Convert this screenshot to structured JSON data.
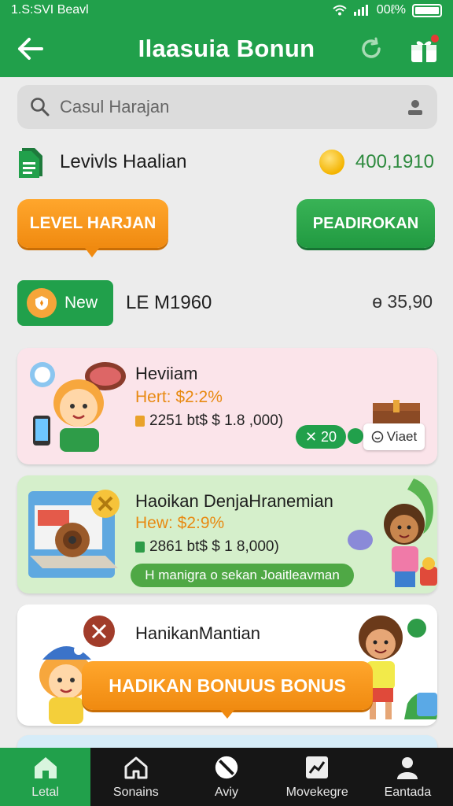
{
  "status_bar": {
    "time": "1.S:SVI Beavl",
    "battery": "00ℓ%"
  },
  "app_bar": {
    "title": "Ilaasuia Bonun"
  },
  "search": {
    "placeholder": "Casul Harajan"
  },
  "level": {
    "label": "Levivls Haalian",
    "coins": "400,1910"
  },
  "actions": {
    "level_button": "LEVEL HARJAN",
    "secondary_button": "PEADIROKAN"
  },
  "new_entry": {
    "badge": "New",
    "title": "LE M1960",
    "amount": "ɵ 35,90"
  },
  "cards": [
    {
      "title": "Heviiam",
      "subtitle": "Hert: $2:2%",
      "meta": "2251 bt$ $ 1.8 ,000)",
      "pill": "✕ 20",
      "pill_secondary": "Viaet"
    },
    {
      "title": "Haoikan DenjaHranemian",
      "subtitle": "Hew: $2:9%",
      "meta": "2861 bt$ $ 1 8,000)",
      "banner": "H manigra o sekan Joaitleavman"
    },
    {
      "title": "HanikanMantian",
      "button": "HADIKAN BONUUS BONUS"
    }
  ],
  "nav": [
    {
      "label": "Letal",
      "icon": "home-icon",
      "active": true
    },
    {
      "label": "Sonains",
      "icon": "house-outline-icon",
      "active": false
    },
    {
      "label": "Aviy",
      "icon": "no-entry-icon",
      "active": false
    },
    {
      "label": "Movekegre",
      "icon": "chart-icon",
      "active": false
    },
    {
      "label": "Eantada",
      "icon": "person-icon",
      "active": false
    }
  ],
  "colors": {
    "primary": "#21a04b",
    "accent": "#f08a10",
    "card1": "#fbe4ea",
    "card2": "#d5efcb",
    "card3": "#ffffff",
    "nav": "#161616"
  }
}
